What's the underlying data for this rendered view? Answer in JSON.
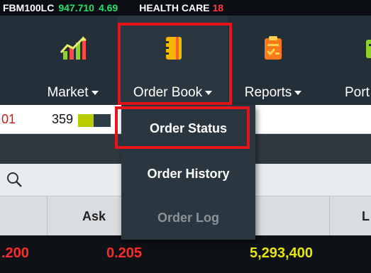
{
  "ticker": {
    "symbol": "FBM100LC",
    "value": "947.710",
    "change": "4.69",
    "sector": "HEALTH CARE",
    "sector_value": "18"
  },
  "nav": {
    "market": {
      "label": "Market",
      "icon": "bar-chart-trend-icon"
    },
    "order_book": {
      "label": "Order Book",
      "icon": "notebook-icon"
    },
    "reports": {
      "label": "Reports",
      "icon": "report-checklist-icon"
    },
    "portfolio": {
      "label": "Port",
      "icon": "portfolio-icon"
    }
  },
  "dropdown": {
    "items": [
      {
        "label": "Order Status",
        "state": "highlighted"
      },
      {
        "label": "Order History",
        "state": "enabled"
      },
      {
        "label": "Order Log",
        "state": "disabled"
      }
    ]
  },
  "table": {
    "row1": {
      "left_value": "01",
      "qty": "359"
    },
    "qty_bar_fill": 0.48,
    "headers": {
      "ask": "Ask",
      "right": "L"
    },
    "data_row": {
      "c1": ".200",
      "c2": "0.205",
      "c3": "5,293,400"
    }
  },
  "colors": {
    "ticker_bg": "#0b0f14",
    "ticker_green": "#22e06b",
    "ticker_red": "#ff3b3b",
    "nav_bg": "#243039",
    "highlight_red": "#e8141b",
    "data_red": "#ff2b2b",
    "data_yellow": "#e6e600"
  }
}
